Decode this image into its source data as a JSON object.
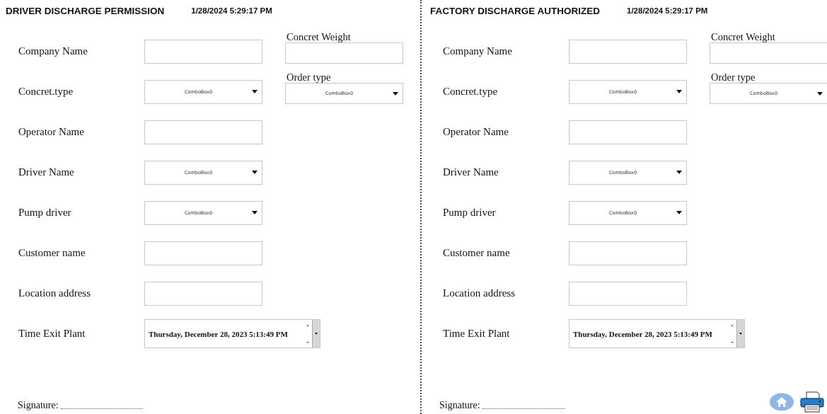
{
  "panels": [
    {
      "title": "DRIVER DISCHARGE PERMISSION",
      "timestamp": "1/28/2024 5:29:17 PM",
      "show_actions": false,
      "side_fields": [
        {
          "label": "Concret Weight",
          "kind": "text"
        },
        {
          "label": "Order type",
          "kind": "combo",
          "value": "ComboBox0"
        }
      ],
      "fields": [
        {
          "label": "Company Name",
          "kind": "text"
        },
        {
          "label": "Concret.type",
          "kind": "combo",
          "value": "ComboBox0"
        },
        {
          "label": "Operator Name",
          "kind": "text"
        },
        {
          "label": "Driver Name",
          "kind": "combo",
          "value": "ComboBox0"
        },
        {
          "label": "Pump driver",
          "kind": "combo",
          "value": "ComboBox0"
        },
        {
          "label": "Customer name",
          "kind": "text"
        },
        {
          "label": "Location address",
          "kind": "text"
        },
        {
          "label": "Time Exit Plant",
          "kind": "datetime",
          "value": "Thursday, December 28, 2023 5:13:49 PM"
        }
      ],
      "signature": "Signature:"
    },
    {
      "title": "FACTORY DISCHARGE AUTHORIZED",
      "timestamp": "1/28/2024 5:29:17 PM",
      "show_actions": true,
      "side_fields": [
        {
          "label": "Concret Weight",
          "kind": "text"
        },
        {
          "label": "Order type",
          "kind": "combo",
          "value": "ComboBox0"
        }
      ],
      "fields": [
        {
          "label": "Company Name",
          "kind": "text"
        },
        {
          "label": "Concret.type",
          "kind": "combo",
          "value": "ComboBox0"
        },
        {
          "label": "Operator Name",
          "kind": "text"
        },
        {
          "label": "Driver Name",
          "kind": "combo",
          "value": "ComboBox0"
        },
        {
          "label": "Pump driver",
          "kind": "combo",
          "value": "ComboBox0"
        },
        {
          "label": "Customer name",
          "kind": "text"
        },
        {
          "label": "Location address",
          "kind": "text"
        },
        {
          "label": "Time Exit Plant",
          "kind": "datetime",
          "value": "Thursday, December 28, 2023 5:13:49 PM"
        }
      ],
      "signature": "Signature:"
    }
  ]
}
